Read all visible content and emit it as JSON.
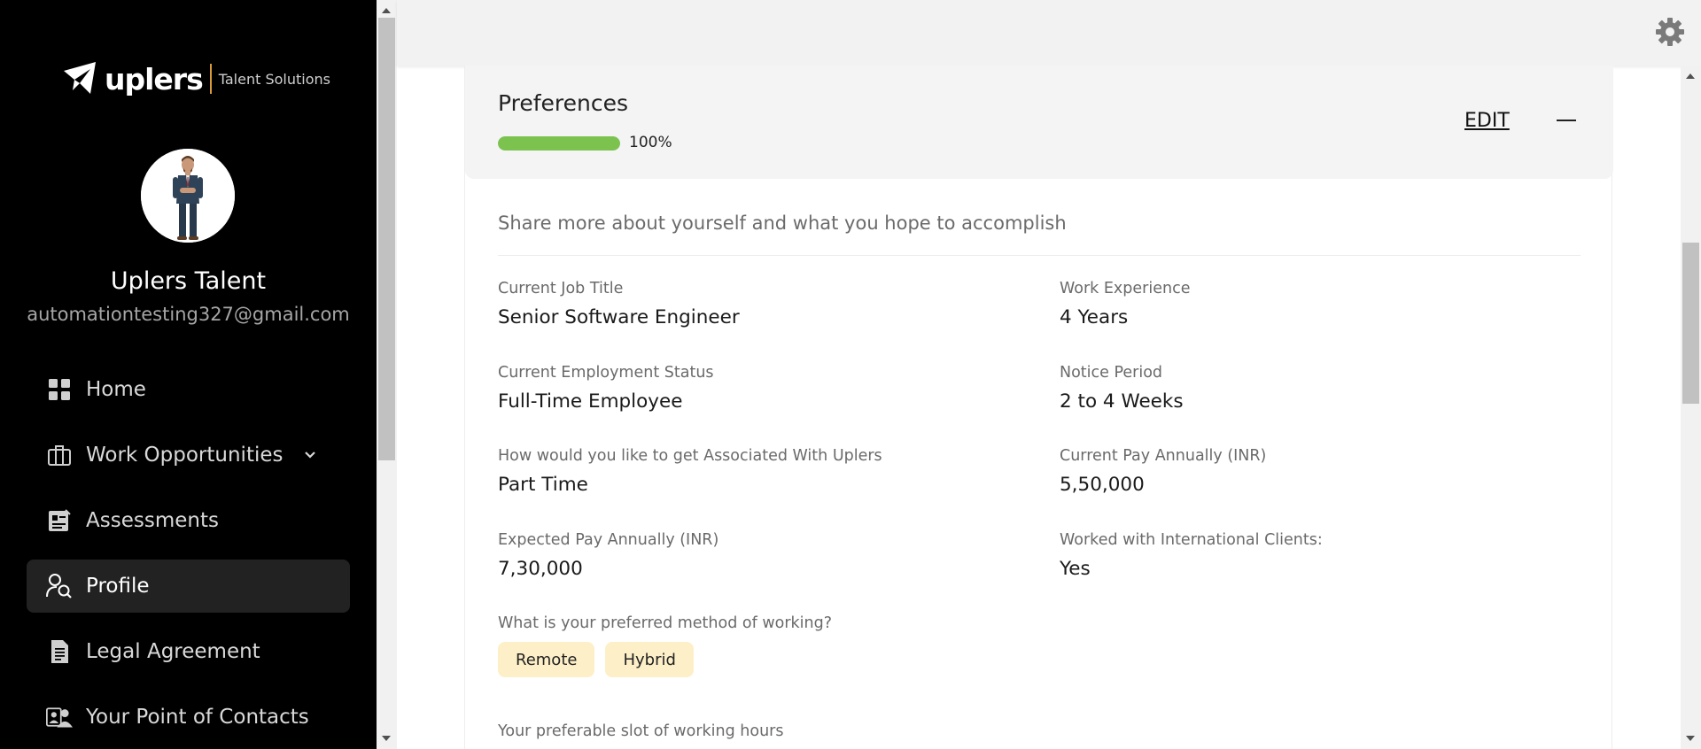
{
  "brand": {
    "name": "uplers",
    "tagline": "Talent Solutions"
  },
  "user": {
    "name": "Uplers Talent",
    "email": "automationtesting327@gmail.com"
  },
  "sidebar": {
    "items": [
      {
        "label": "Home",
        "icon": "grid-icon"
      },
      {
        "label": "Work Opportunities",
        "icon": "briefcase-icon",
        "has_submenu": true
      },
      {
        "label": "Assessments",
        "icon": "assessment-icon"
      },
      {
        "label": "Profile",
        "icon": "profile-search-icon",
        "active": true
      },
      {
        "label": "Legal Agreement",
        "icon": "document-icon"
      },
      {
        "label": "Your Point of Contacts",
        "icon": "contacts-icon"
      }
    ]
  },
  "topbar": {
    "settings_icon": "gear-icon"
  },
  "preferences": {
    "title": "Preferences",
    "progress": 100,
    "progress_text": "100%",
    "edit_label": "EDIT",
    "description": "Share more about yourself and what you hope to accomplish",
    "fields": [
      {
        "label": "Current Job Title",
        "value": "Senior Software Engineer"
      },
      {
        "label": "Work Experience",
        "value": "4 Years"
      },
      {
        "label": "Current Employment Status",
        "value": "Full-Time Employee"
      },
      {
        "label": "Notice Period",
        "value": "2 to 4 Weeks"
      },
      {
        "label": "How would you like to get Associated With Uplers",
        "value": "Part Time"
      },
      {
        "label": "Current Pay Annually (INR)",
        "value": "5,50,000"
      },
      {
        "label": "Expected Pay Annually (INR)",
        "value": "7,30,000"
      },
      {
        "label": "Worked with International Clients:",
        "value": "Yes"
      }
    ],
    "working_method": {
      "label": "What is your preferred method of working?",
      "options": [
        "Remote",
        "Hybrid"
      ]
    },
    "slot_label": "Your preferable slot of working hours"
  },
  "colors": {
    "sidebar_bg": "#000000",
    "progress_fill": "#7bc24f",
    "chip_bg": "#fdf0c8",
    "active_nav_bg": "#222222"
  }
}
